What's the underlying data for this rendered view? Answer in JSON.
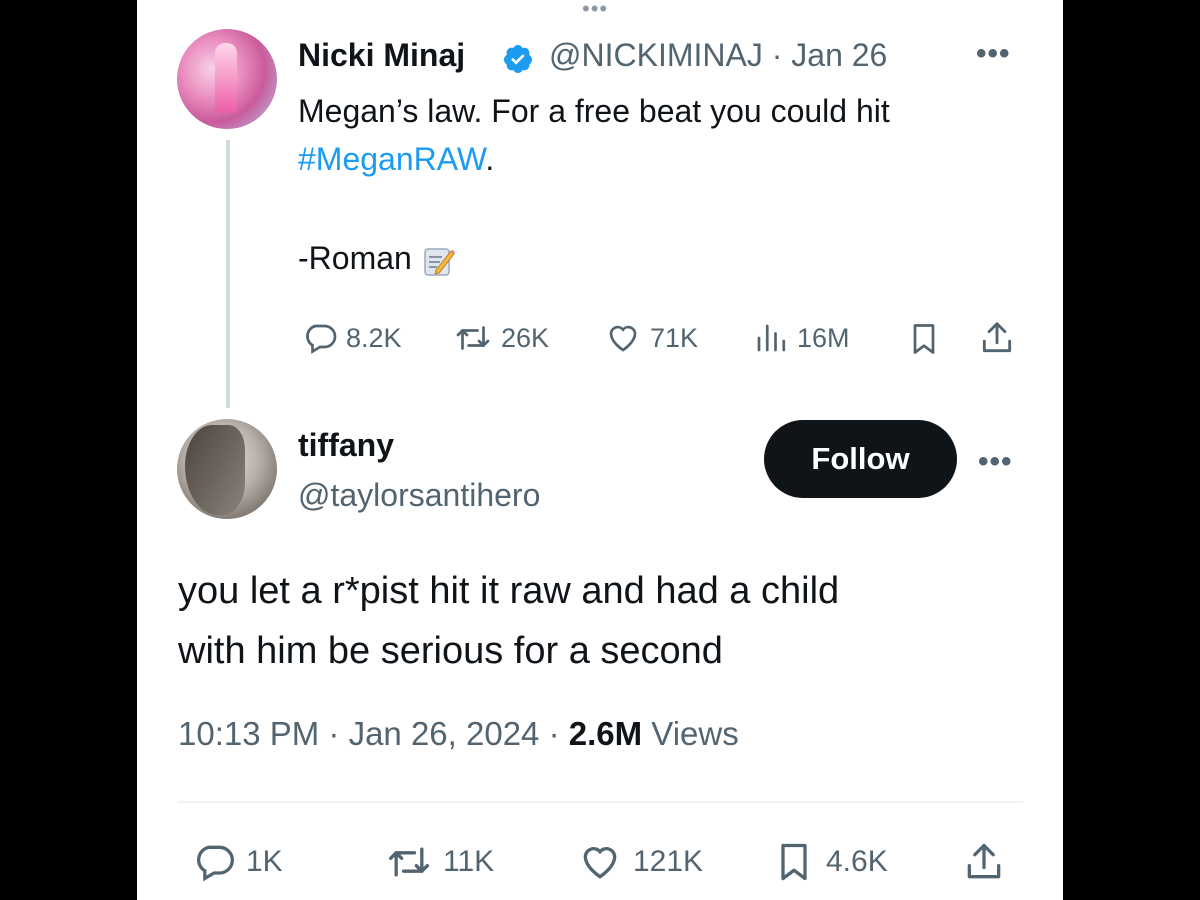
{
  "top_more": "•••",
  "original_tweet": {
    "author_name": "Nicki Minaj",
    "handle_date": "@NICKIMINAJ · Jan 26",
    "more": "•••",
    "text_line1": "Megan’s law. For a free beat you could hit",
    "hashtag": "#MeganRAW",
    "text_after_hashtag": ".",
    "signature": "-Roman",
    "stats": {
      "replies": "8.2K",
      "retweets": "26K",
      "likes": "71K",
      "views": "16M"
    },
    "icons": [
      "reply-icon",
      "retweet-icon",
      "like-icon",
      "views-icon",
      "bookmark-icon",
      "share-icon",
      "verified-badge-icon",
      "memo-emoji"
    ]
  },
  "reply_tweet": {
    "author_name": "tiffany",
    "handle": "@taylorsantihero",
    "follow_label": "Follow",
    "more": "•••",
    "text_line1": "you let a r*pist hit it raw and had a child",
    "text_line2": "with him be serious for a second",
    "meta_time": "10:13 PM · Jan 26, 2024 · ",
    "meta_views_count": "2.6M",
    "meta_views_label": " Views",
    "stats": {
      "replies": "1K",
      "retweets": "11K",
      "likes": "121K",
      "bookmarks": "4.6K"
    }
  },
  "colors": {
    "background": "#000000",
    "panel": "#ffffff",
    "text": "#0f1419",
    "secondary": "#536471",
    "link": "#1d9bf0",
    "thread_line": "#cfd9de"
  }
}
